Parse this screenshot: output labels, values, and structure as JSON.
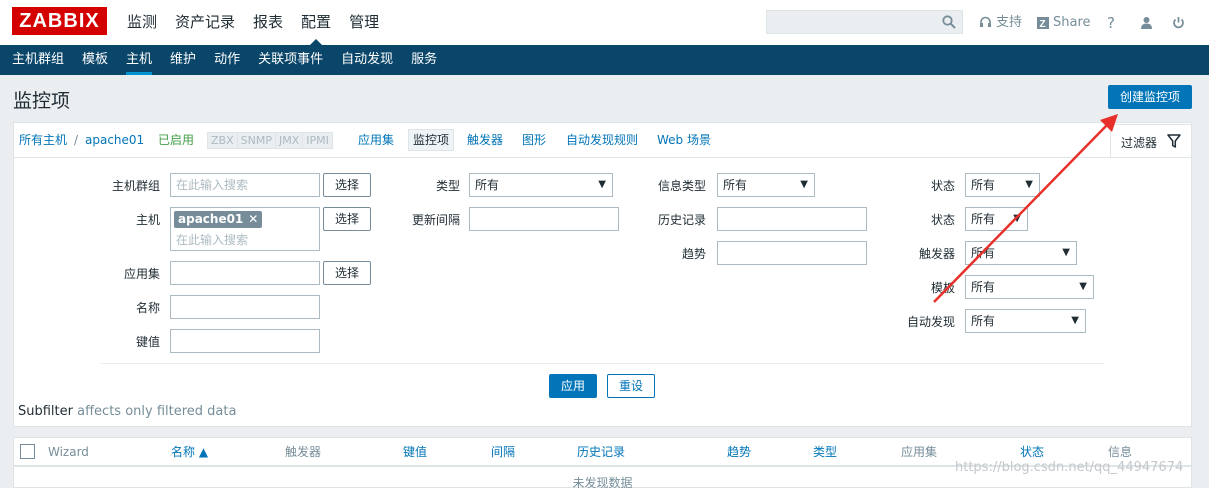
{
  "header": {
    "logo": "ZABBIX",
    "menu": [
      "监测",
      "资产记录",
      "报表",
      "配置",
      "管理"
    ],
    "active_menu": "配置",
    "search_placeholder": "",
    "support": "支持",
    "share": "Share",
    "help": "?"
  },
  "submenu": {
    "items": [
      "主机群组",
      "模板",
      "主机",
      "维护",
      "动作",
      "关联项事件",
      "自动发现",
      "服务"
    ],
    "active": "主机"
  },
  "page": {
    "title": "监控项",
    "create_button": "创建监控项"
  },
  "hostnav": {
    "all_hosts": "所有主机",
    "separator": "/",
    "host": "apache01",
    "status": "已启用",
    "availability": [
      "ZBX",
      "SNMP",
      "JMX",
      "IPMI"
    ],
    "tabs": [
      "应用集",
      "监控项",
      "触发器",
      "图形",
      "自动发现规则",
      "Web 场景"
    ],
    "active_tab": "监控项"
  },
  "filter": {
    "tab_label": "过滤器",
    "host_group_label": "主机群组",
    "host_group_placeholder": "在此输入搜索",
    "host_label": "主机",
    "host_chip": "apache01",
    "host_placeholder": "在此输入搜索",
    "application_label": "应用集",
    "name_label": "名称",
    "key_label": "键值",
    "select_button": "选择",
    "type_label": "类型",
    "type_value": "所有",
    "update_interval_label": "更新间隔",
    "info_type_label": "信息类型",
    "info_type_value": "所有",
    "history_label": "历史记录",
    "trends_label": "趋势",
    "state_label": "状态",
    "state_value": "所有",
    "status_label": "状态",
    "status_value": "所有",
    "triggers_label": "触发器",
    "triggers_value": "所有",
    "template_label": "模板",
    "template_value": "所有",
    "discovery_label": "自动发现",
    "discovery_value": "所有",
    "apply_button": "应用",
    "reset_button": "重设",
    "subfilter_title": "Subfilter",
    "subfilter_note": "affects only filtered data"
  },
  "table": {
    "columns": [
      "Wizard",
      "名称 ▲",
      "触发器",
      "键值",
      "间隔",
      "历史记录",
      "趋势",
      "类型",
      "应用集",
      "状态",
      "信息"
    ],
    "empty_text": "未发现数据"
  },
  "watermark": "https://blog.csdn.net/qq_44947674",
  "colors": {
    "logo": "#d40000",
    "nav_dark": "#0a466a",
    "primary": "#0275b8",
    "enabled": "#429e47",
    "annotation_arrow": "#e8302a"
  }
}
